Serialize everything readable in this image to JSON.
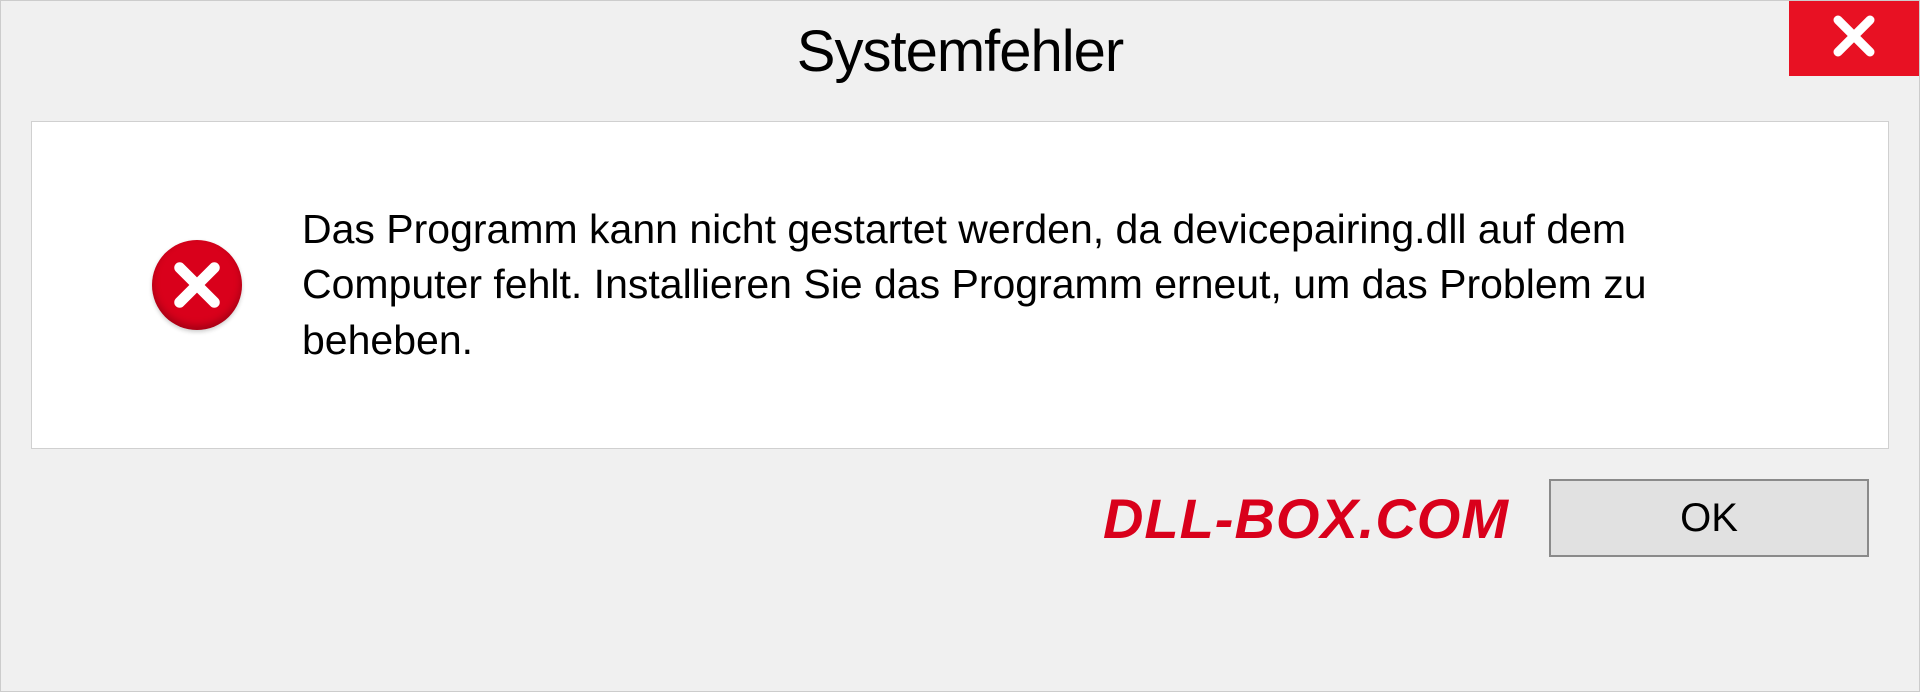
{
  "dialog": {
    "title": "Systemfehler",
    "message": "Das Programm kann nicht gestartet werden, da devicepairing.dll auf dem Computer fehlt. Installieren Sie das Programm erneut, um das Problem zu beheben.",
    "ok_label": "OK",
    "watermark": "DLL-BOX.COM"
  },
  "colors": {
    "close_bg": "#e81123",
    "error_icon": "#d9001b",
    "panel_bg": "#f0f0f0"
  }
}
